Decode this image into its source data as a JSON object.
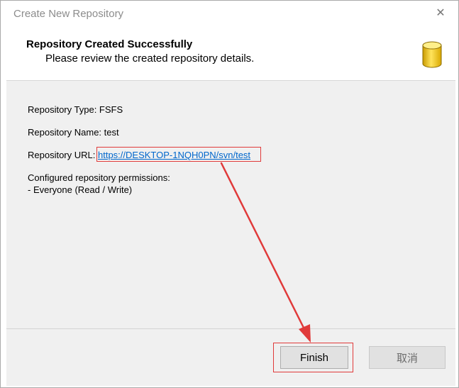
{
  "window": {
    "title": "Create New Repository",
    "close_glyph": "✕"
  },
  "header": {
    "title": "Repository Created Successfully",
    "subtitle": "Please review the created repository details.",
    "icon": "database-icon"
  },
  "details": {
    "type_line": "Repository Type: FSFS",
    "name_line": "Repository Name: test",
    "url_label": "Repository URL: ",
    "url": "https://DESKTOP-1NQH0PN/svn/test",
    "permissions_heading": "Configured repository permissions:",
    "permissions_entry": "- Everyone (Read / Write)"
  },
  "buttons": {
    "finish_label": "Finish",
    "cancel_label": "取消"
  },
  "annotation": {
    "highlight_color": "#e03a3a"
  }
}
